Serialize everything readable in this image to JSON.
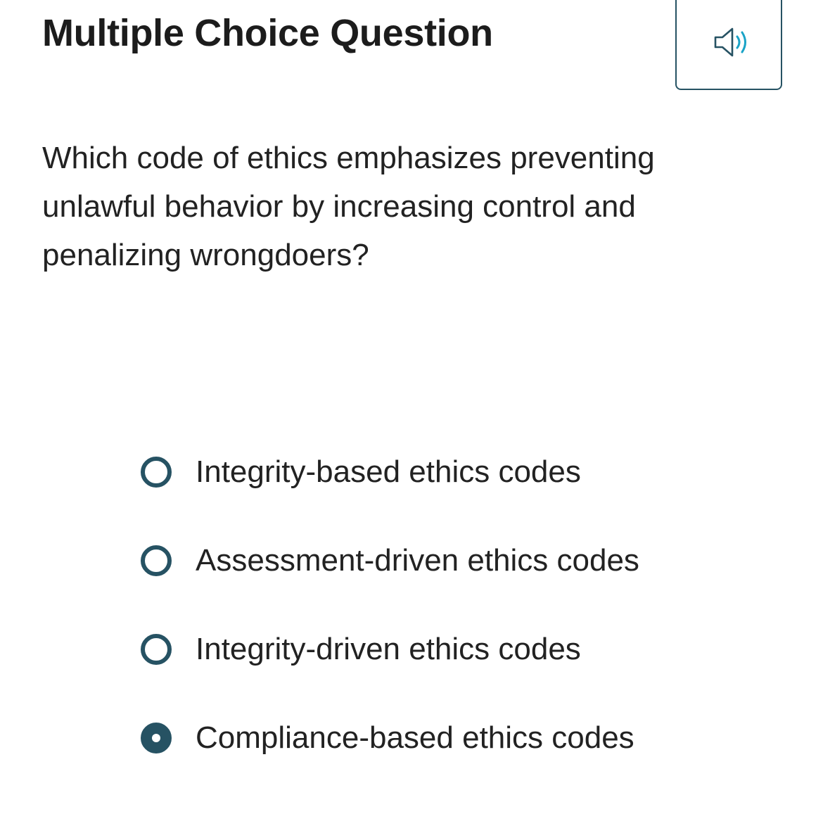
{
  "header": {
    "title": "Multiple Choice Question",
    "audio_icon": "speaker-icon"
  },
  "question": {
    "text": "Which code of ethics emphasizes preventing unlawful behavior by increasing control and penalizing wrongdoers?"
  },
  "options": [
    {
      "label": "Integrity-based ethics codes",
      "selected": false
    },
    {
      "label": "Assessment-driven ethics codes",
      "selected": false
    },
    {
      "label": "Integrity-driven ethics codes",
      "selected": false
    },
    {
      "label": "Compliance-based ethics codes",
      "selected": true
    }
  ],
  "colors": {
    "accent": "#265263",
    "speaker_waves": "#1aa3c7",
    "text": "#222222"
  }
}
